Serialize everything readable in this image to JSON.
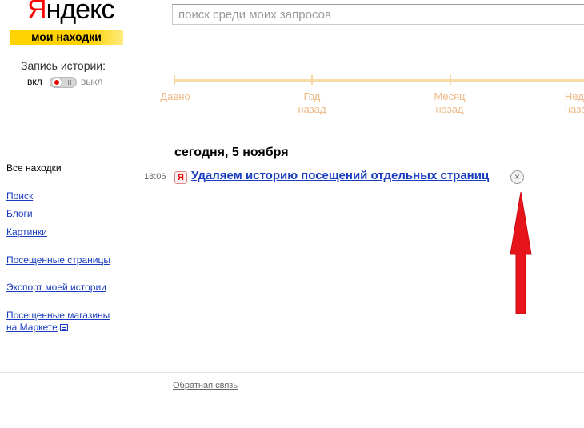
{
  "logo": {
    "brand_first": "Я",
    "brand_rest": "ндекс",
    "service": "мои находки"
  },
  "search": {
    "placeholder": "поиск среди моих запросов",
    "value": ""
  },
  "history": {
    "label": "Запись истории:",
    "on_label": "вкл",
    "off_label": "выкл",
    "state": "on"
  },
  "timeline": {
    "labels": [
      {
        "line1": "Давно",
        "line2": ""
      },
      {
        "line1": "Год",
        "line2": "назад"
      },
      {
        "line1": "Месяц",
        "line2": "назад"
      },
      {
        "line1": "Неделю",
        "line2": "назад"
      }
    ]
  },
  "sidebar": {
    "all_finds": "Все находки",
    "links": [
      "Поиск",
      "Блоги",
      "Картинки",
      "Посещенные страницы",
      "Экспорт моей истории"
    ],
    "market_line1": "Посещенные магазины",
    "market_line2": "на Маркете"
  },
  "main": {
    "day_heading": "сегодня, 5 ноября",
    "entries": [
      {
        "time": "18:06",
        "favicon_letter": "Я",
        "title": "Удаляем историю посещений отдельных страниц",
        "remove_symbol": "×"
      }
    ]
  },
  "footer": {
    "feedback": "Обратная связь"
  },
  "colors": {
    "link": "#1a3dc1",
    "brand_red": "#ff0000",
    "brand_yellow": "#ffd200",
    "timeline": "#efb987",
    "arrow": "#e8141c"
  }
}
